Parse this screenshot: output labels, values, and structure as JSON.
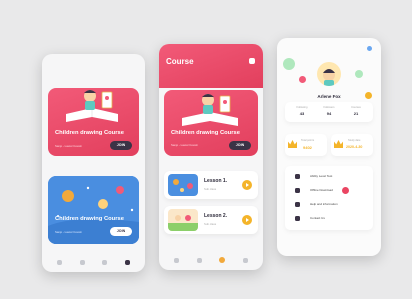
{
  "screen1": {
    "card1": {
      "title": "Children drawing Course",
      "subtitle": "Sanjo - Laurel Cousin",
      "button": "JOIN"
    },
    "card2": {
      "title": "Children drawing Course",
      "subtitle": "Sanjo - Laurel Cousin",
      "button": "JOIN"
    }
  },
  "screen2": {
    "header_title": "Course",
    "card": {
      "title": "Children drawing Course",
      "subtitle": "Sanjo - Laurel Cousin",
      "button": "JOIN"
    },
    "lessons": [
      {
        "title": "Lesson 1.",
        "subtitle": "Sub class"
      },
      {
        "title": "Lesson 2.",
        "subtitle": "Sub class"
      }
    ]
  },
  "screen3": {
    "name": "Arlene Fox",
    "stats": [
      {
        "label": "Following",
        "value": "43"
      },
      {
        "label": "Followers",
        "value": "94"
      },
      {
        "label": "Courses",
        "value": "21"
      }
    ],
    "points": {
      "label": "Total points",
      "value": "9402"
    },
    "date": {
      "label": "Study date",
      "value": "2020-4-30"
    },
    "menu": [
      {
        "label": "Ability Level Test",
        "icon": "document-icon"
      },
      {
        "label": "Offline Download",
        "icon": "download-icon",
        "badge": true
      },
      {
        "label": "Help and information",
        "icon": "help-icon"
      },
      {
        "label": "Contact Us",
        "icon": "chat-icon"
      }
    ]
  },
  "colors": {
    "accent_pink": "#e84764",
    "accent_yellow": "#f4b42a",
    "dark": "#3b3346",
    "blue_card": "#4b8fe0"
  }
}
